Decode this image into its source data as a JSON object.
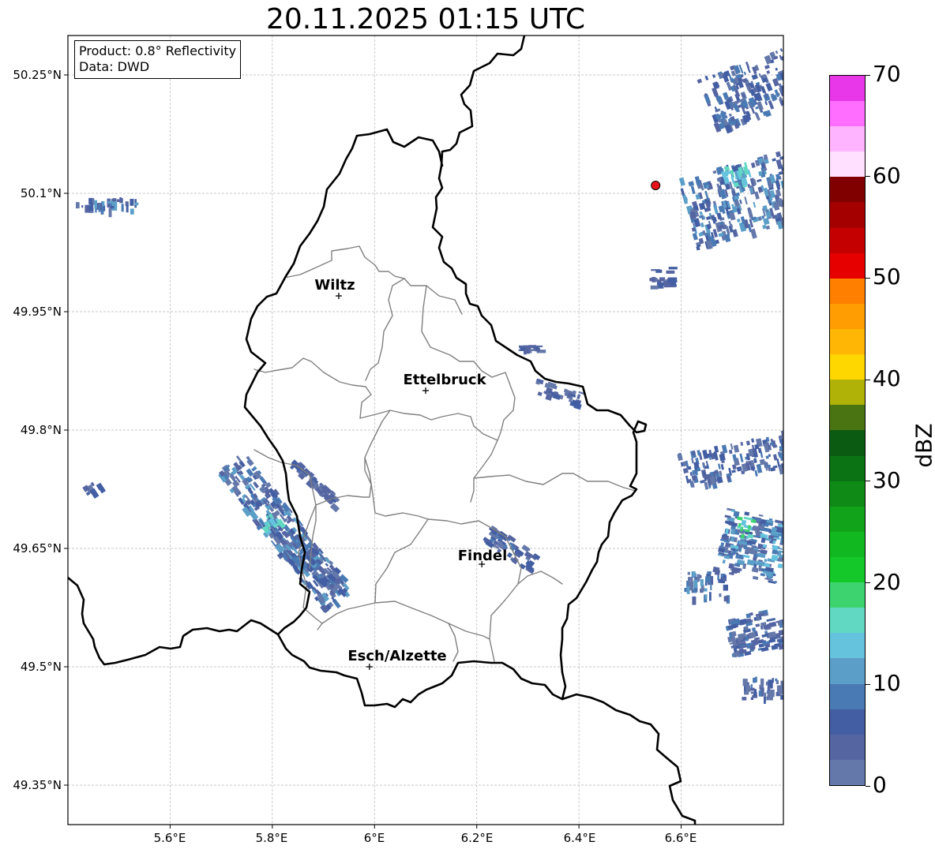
{
  "title": "20.11.2025 01:15 UTC",
  "info": {
    "product": "Product: 0.8° Reflectivity",
    "source": "Data: DWD"
  },
  "axes": {
    "lat_labels": [
      "50.25°N",
      "50.1°N",
      "49.95°N",
      "49.8°N",
      "49.65°N",
      "49.5°N",
      "49.35°N"
    ],
    "lat_values": [
      50.25,
      50.1,
      49.95,
      49.8,
      49.65,
      49.5,
      49.35
    ],
    "lon_labels": [
      "5.6°E",
      "5.8°E",
      "6°E",
      "6.2°E",
      "6.4°E",
      "6.6°E"
    ],
    "lon_values": [
      5.6,
      5.8,
      6.0,
      6.2,
      6.4,
      6.6
    ],
    "extent": {
      "lon_min": 5.4,
      "lon_max": 6.8,
      "lat_min": 49.3,
      "lat_max": 50.3
    },
    "grid": true
  },
  "cities": [
    {
      "name": "Wiltz",
      "lon": 5.93,
      "lat": 49.97
    },
    {
      "name": "Ettelbruck",
      "lon": 6.1,
      "lat": 49.85
    },
    {
      "name": "Findel",
      "lon": 6.21,
      "lat": 49.63
    },
    {
      "name": "Esch/Alzette",
      "lon": 5.99,
      "lat": 49.5
    }
  ],
  "radar_site": {
    "lon": 6.55,
    "lat": 50.11,
    "color": "#e8101a"
  },
  "colorbar": {
    "unit": "dBZ",
    "min": 0,
    "max": 70,
    "step": 2.5,
    "tick_labels": [
      "0",
      "10",
      "20",
      "30",
      "40",
      "50",
      "60",
      "70"
    ],
    "tick_values": [
      0,
      10,
      20,
      30,
      40,
      50,
      60,
      70
    ],
    "colors": [
      "#6478aa",
      "#5565a2",
      "#435ea2",
      "#4a7ab4",
      "#5b9fc8",
      "#65c3de",
      "#60d8c2",
      "#3dd470",
      "#15c82a",
      "#12b820",
      "#11a41b",
      "#0f8a17",
      "#0c7314",
      "#0b5c12",
      "#4a7412",
      "#b0b207",
      "#ffd700",
      "#ffb605",
      "#ff9d02",
      "#ff7f00",
      "#e60000",
      "#c40000",
      "#a50000",
      "#800000",
      "#ffe0ff",
      "#ffb4ff",
      "#ff6eff",
      "#e837e8"
    ]
  }
}
